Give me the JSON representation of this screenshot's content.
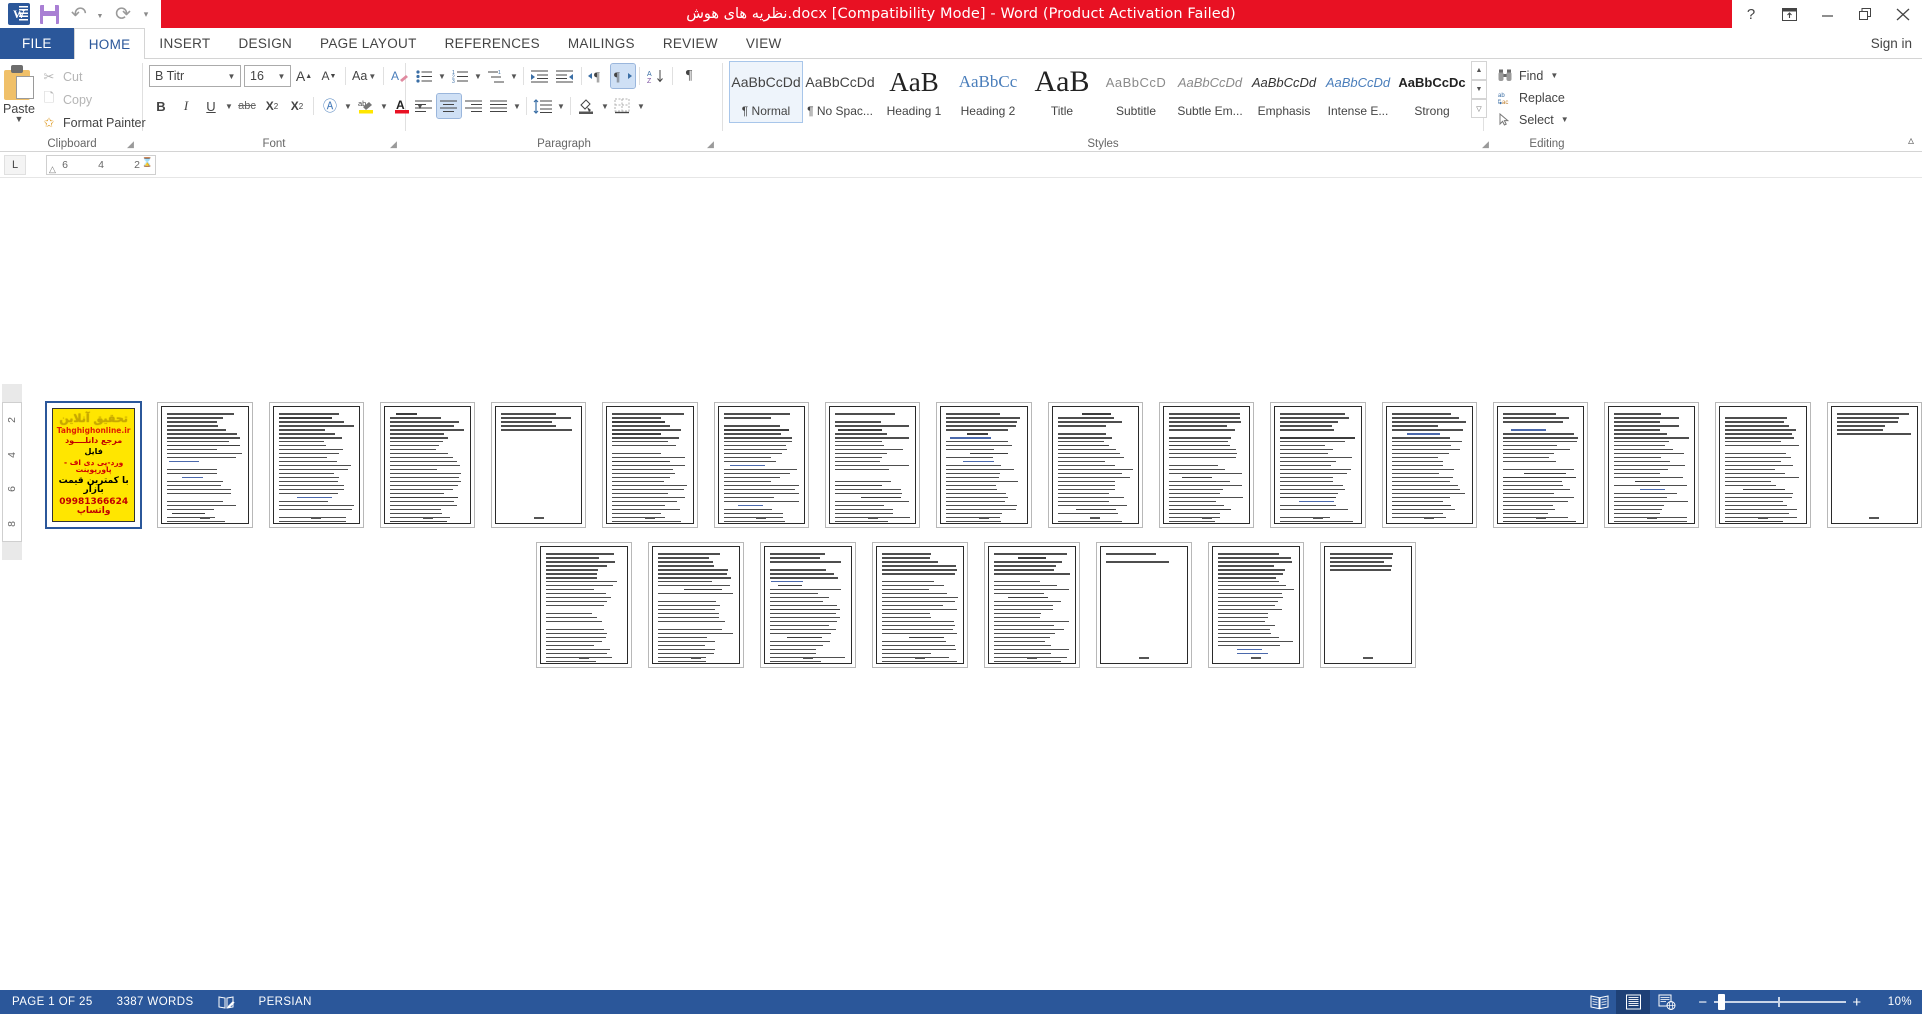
{
  "titlebar": {
    "document_title": "نظریه های هوش.docx [Compatibility Mode]  -  Word (Product Activation Failed)",
    "qat": [
      {
        "name": "word-logo-icon",
        "label": "W"
      },
      {
        "name": "save-icon",
        "label": "Save"
      },
      {
        "name": "undo-icon",
        "label": "Undo"
      },
      {
        "name": "redo-icon",
        "label": "Redo"
      },
      {
        "name": "customize-qat-icon",
        "label": "Customize Quick Access Toolbar"
      }
    ],
    "help": "?",
    "ribbon_display_options": "Ribbon Display Options",
    "minimize": "—",
    "restore": "Restore Down",
    "close": "✕"
  },
  "tabs": [
    {
      "label": "FILE",
      "name": "tab-file"
    },
    {
      "label": "HOME",
      "name": "tab-home"
    },
    {
      "label": "INSERT",
      "name": "tab-insert"
    },
    {
      "label": "DESIGN",
      "name": "tab-design"
    },
    {
      "label": "PAGE LAYOUT",
      "name": "tab-page-layout"
    },
    {
      "label": "REFERENCES",
      "name": "tab-references"
    },
    {
      "label": "MAILINGS",
      "name": "tab-mailings"
    },
    {
      "label": "REVIEW",
      "name": "tab-review"
    },
    {
      "label": "VIEW",
      "name": "tab-view"
    }
  ],
  "sign_in": "Sign in",
  "ribbon": {
    "clipboard": {
      "group_label": "Clipboard",
      "paste": "Paste",
      "cut": "Cut",
      "copy": "Copy",
      "format_painter": "Format Painter"
    },
    "font": {
      "group_label": "Font",
      "font_name": "B Titr",
      "font_size": "16",
      "grow_font": "A",
      "shrink_font": "A",
      "change_case": "Aa",
      "clear_formatting": "A",
      "bold": "B",
      "italic": "I",
      "underline": "U",
      "strikethrough": "abc",
      "subscript": "X",
      "superscript": "X",
      "text_effects": "A",
      "text_highlight": "ab",
      "font_color": "A"
    },
    "paragraph": {
      "group_label": "Paragraph",
      "bullets": "Bullets",
      "numbering": "Numbering",
      "multilevel_list": "Multilevel List",
      "decrease_indent": "Decrease Indent",
      "increase_indent": "Increase Indent",
      "ltr_direction": "Left-to-Right Text Direction",
      "rtl_direction": "Right-to-Left Text Direction",
      "sort": "Sort",
      "show_marks": "¶",
      "align_left": "Align Left",
      "center": "Center",
      "align_right": "Align Right",
      "justify": "Justify",
      "line_spacing": "Line and Paragraph Spacing",
      "shading": "Shading",
      "borders": "Borders"
    },
    "styles": {
      "group_label": "Styles",
      "items": [
        {
          "sample": "AaBbCcDd",
          "name": "¶ Normal",
          "selected": true
        },
        {
          "sample": "AaBbCcDd",
          "name": "¶ No Spac...",
          "selected": false
        },
        {
          "sample": "AaB",
          "name": "Heading 1",
          "selected": false
        },
        {
          "sample": "AaBbCc",
          "name": "Heading 2",
          "selected": false
        },
        {
          "sample": "AaB",
          "name": "Title",
          "selected": false
        },
        {
          "sample": "AaBbCcD",
          "name": "Subtitle",
          "selected": false
        },
        {
          "sample": "AaBbCcDd",
          "name": "Subtle Em...",
          "selected": false
        },
        {
          "sample": "AaBbCcDd",
          "name": "Emphasis",
          "selected": false
        },
        {
          "sample": "AaBbCcDd",
          "name": "Intense E...",
          "selected": false
        },
        {
          "sample": "AaBbCcDc",
          "name": "Strong",
          "selected": false
        }
      ]
    },
    "editing": {
      "group_label": "Editing",
      "find": "Find",
      "replace": "Replace",
      "select": "Select"
    },
    "collapse": "Collapse the Ribbon"
  },
  "ruler": {
    "tab_selector": "L",
    "horizontal_ticks": [
      "6",
      "4",
      "2"
    ],
    "vertical_ticks": [
      "2",
      "4",
      "6",
      "8"
    ]
  },
  "document": {
    "ad_page": {
      "line1": "تحقیق آنلاین",
      "line2": "Tahghighonline.ir",
      "line3": "مرجع دانلــــود",
      "line4": "فایل",
      "line5": "ورد-پی دی اف - پاورپوینت",
      "line6": "با کمترین قیمت بازار",
      "line7": "09981366624 واتساپ"
    },
    "row1_pages": 17,
    "row2_pages": 8,
    "total_pages": 25
  },
  "statusbar": {
    "page_indicator": "PAGE 1 OF 25",
    "word_count": "3387 WORDS",
    "proofing_icon": "proofing-errors-icon",
    "language": "PERSIAN",
    "view_read_mode": "Read Mode",
    "view_print_layout": "Print Layout",
    "view_web_layout": "Web Layout",
    "zoom_out": "−",
    "zoom_in": "+",
    "zoom_level": "10%"
  }
}
